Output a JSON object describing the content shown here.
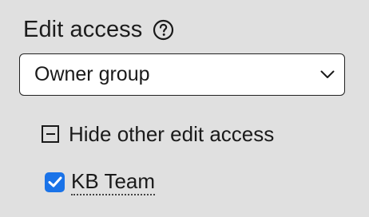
{
  "edit_access": {
    "title": "Edit access",
    "help_icon": "question-circle-icon",
    "select": {
      "selected_value": "Owner group",
      "chevron_icon": "chevron-down-icon"
    },
    "collapse_toggle": {
      "icon": "minus-square-icon",
      "label": "Hide other edit access"
    },
    "groups": [
      {
        "label": "KB Team",
        "checked": true
      }
    ],
    "colors": {
      "background": "#e0e0e0",
      "checkbox_accent": "#1a73e8"
    }
  }
}
